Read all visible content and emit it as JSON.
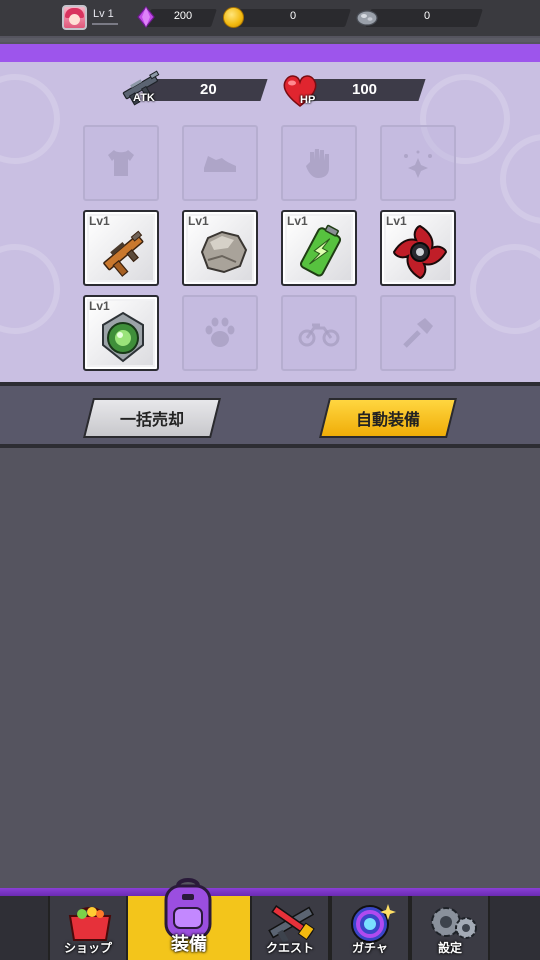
{
  "player": {
    "level_label": "Lv 1"
  },
  "currency": {
    "gems": "200",
    "coins": "0",
    "ore": "0"
  },
  "stats": {
    "atk_label": "ATK",
    "atk_value": "20",
    "hp_label": "HP",
    "hp_value": "100"
  },
  "slots": {
    "row1": [
      {
        "icon": "shirt-icon"
      },
      {
        "icon": "shoe-icon"
      },
      {
        "icon": "glove-icon"
      },
      {
        "icon": "sparkle-icon"
      }
    ],
    "row2": [
      {
        "level": "Lv1",
        "icon": "rifle-icon"
      },
      {
        "level": "Lv1",
        "icon": "rock-icon"
      },
      {
        "level": "Lv1",
        "icon": "battery-icon"
      },
      {
        "level": "Lv1",
        "icon": "shuriken-icon"
      }
    ],
    "row3": [
      {
        "level": "Lv1",
        "icon": "shield-orb-icon"
      },
      {
        "icon": "paw-icon"
      },
      {
        "icon": "motorcycle-icon"
      },
      {
        "icon": "hammer-icon"
      }
    ]
  },
  "buttons": {
    "bulk_sell": "一括売却",
    "auto_equip": "自動装備"
  },
  "nav": {
    "shop": "ショップ",
    "equip": "装備",
    "quest": "クエスト",
    "gacha": "ガチャ",
    "settings": "設定"
  },
  "colors": {
    "accent_purple": "#9d55ec",
    "active_tab": "#f3c51b",
    "panel": "#c9bfe2"
  }
}
